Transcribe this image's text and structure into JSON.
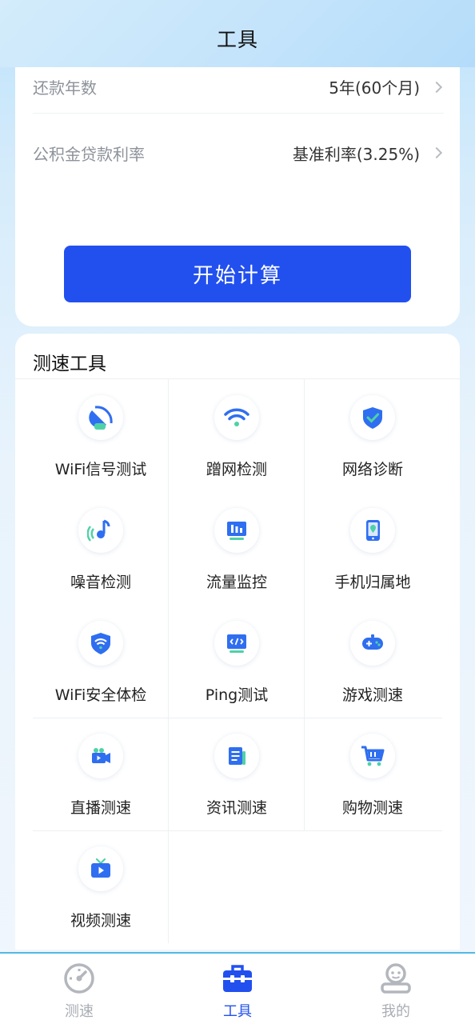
{
  "header": {
    "title": "工具"
  },
  "calc": {
    "rows": [
      {
        "label": "还款年数",
        "value": "5年(60个月)"
      },
      {
        "label": "公积金贷款利率",
        "value": "基准利率(3.25%)"
      }
    ],
    "button_label": "开始计算"
  },
  "tools": {
    "title": "测速工具",
    "items": [
      {
        "label": "WiFi信号测试",
        "icon": "satellite-dish-icon"
      },
      {
        "label": "蹭网检测",
        "icon": "wifi-icon"
      },
      {
        "label": "网络诊断",
        "icon": "shield-check-icon"
      },
      {
        "label": "噪音检测",
        "icon": "music-note-icon"
      },
      {
        "label": "流量监控",
        "icon": "bar-monitor-icon"
      },
      {
        "label": "手机归属地",
        "icon": "phone-location-icon"
      },
      {
        "label": "WiFi安全体检",
        "icon": "wifi-shield-icon"
      },
      {
        "label": "Ping测试",
        "icon": "code-monitor-icon"
      },
      {
        "label": "游戏测速",
        "icon": "gamepad-icon"
      },
      {
        "label": "直播测速",
        "icon": "video-camera-icon"
      },
      {
        "label": "资讯测速",
        "icon": "news-icon"
      },
      {
        "label": "购物测速",
        "icon": "shopping-cart-icon"
      },
      {
        "label": "视频测速",
        "icon": "tv-play-icon"
      }
    ]
  },
  "tabbar": {
    "items": [
      {
        "label": "测速",
        "icon": "speedometer-icon",
        "active": false
      },
      {
        "label": "工具",
        "icon": "toolbox-icon",
        "active": true
      },
      {
        "label": "我的",
        "icon": "profile-icon",
        "active": false
      }
    ]
  },
  "colors": {
    "accent": "#2250ef",
    "tab_inactive": "#a9adb3",
    "icon_blue": "#2f6ef0",
    "icon_green": "#4fd1a8"
  }
}
